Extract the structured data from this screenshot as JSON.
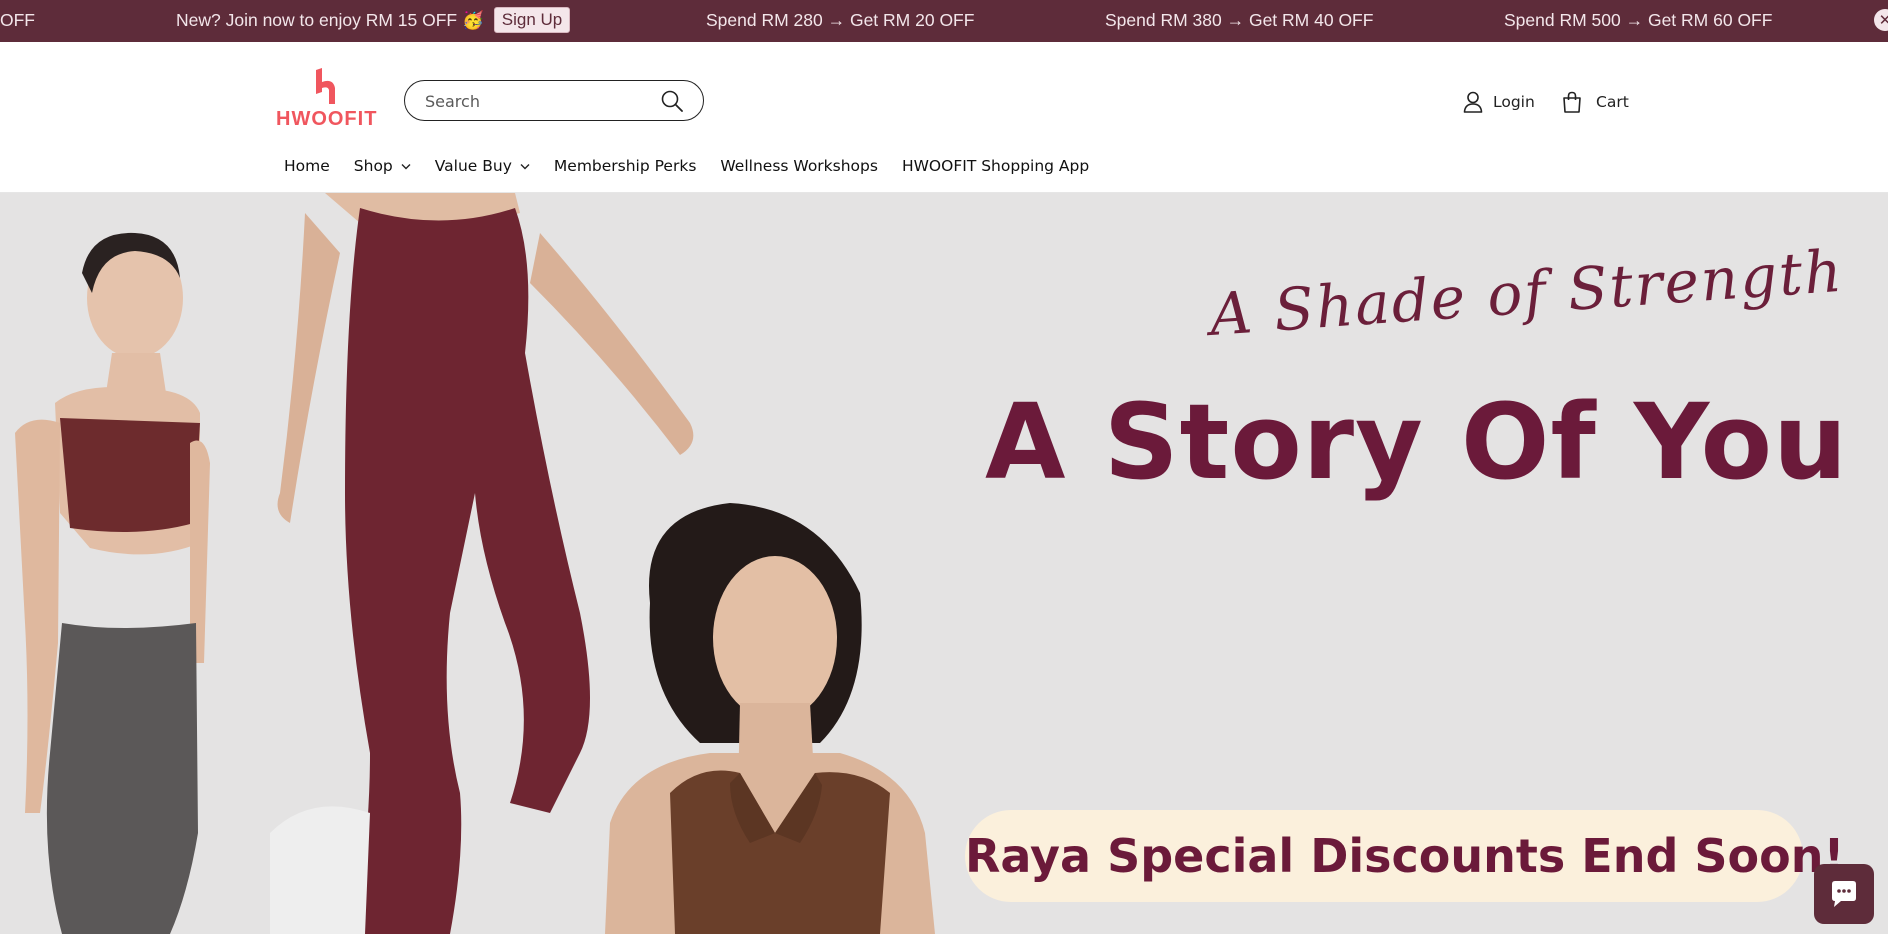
{
  "announcement": {
    "items": [
      "OFF",
      "New? Join now to enjoy RM 15 OFF 🥳",
      "Spend RM 280 → Get RM 20 OFF",
      "Spend RM 380 → Get RM 40 OFF",
      "Spend RM 500 → Get RM 60 OFF"
    ],
    "signup_label": "Sign Up",
    "close_symbol": "✕",
    "background": "#5e2c3a"
  },
  "header": {
    "logo_text": "HWOOFIT",
    "logo_color": "#f0565e",
    "search": {
      "placeholder": "Search",
      "icon": "search-icon"
    },
    "account_label": "Login",
    "cart_label": "Cart"
  },
  "nav": {
    "items": [
      {
        "label": "Home",
        "has_dropdown": false
      },
      {
        "label": "Shop",
        "has_dropdown": true
      },
      {
        "label": "Value Buy",
        "has_dropdown": true
      },
      {
        "label": "Membership Perks",
        "has_dropdown": false
      },
      {
        "label": "Wellness Workshops",
        "has_dropdown": false
      },
      {
        "label": "HWOOFIT Shopping App",
        "has_dropdown": false
      }
    ]
  },
  "hero": {
    "script_title": "A Shade of Strength",
    "title": "A Story Of You",
    "banner_text": "Raya Special Discounts End Soon!",
    "accent": "#6b1a3a",
    "background": "#e4e3e3"
  },
  "chat": {
    "icon": "chat-icon"
  }
}
